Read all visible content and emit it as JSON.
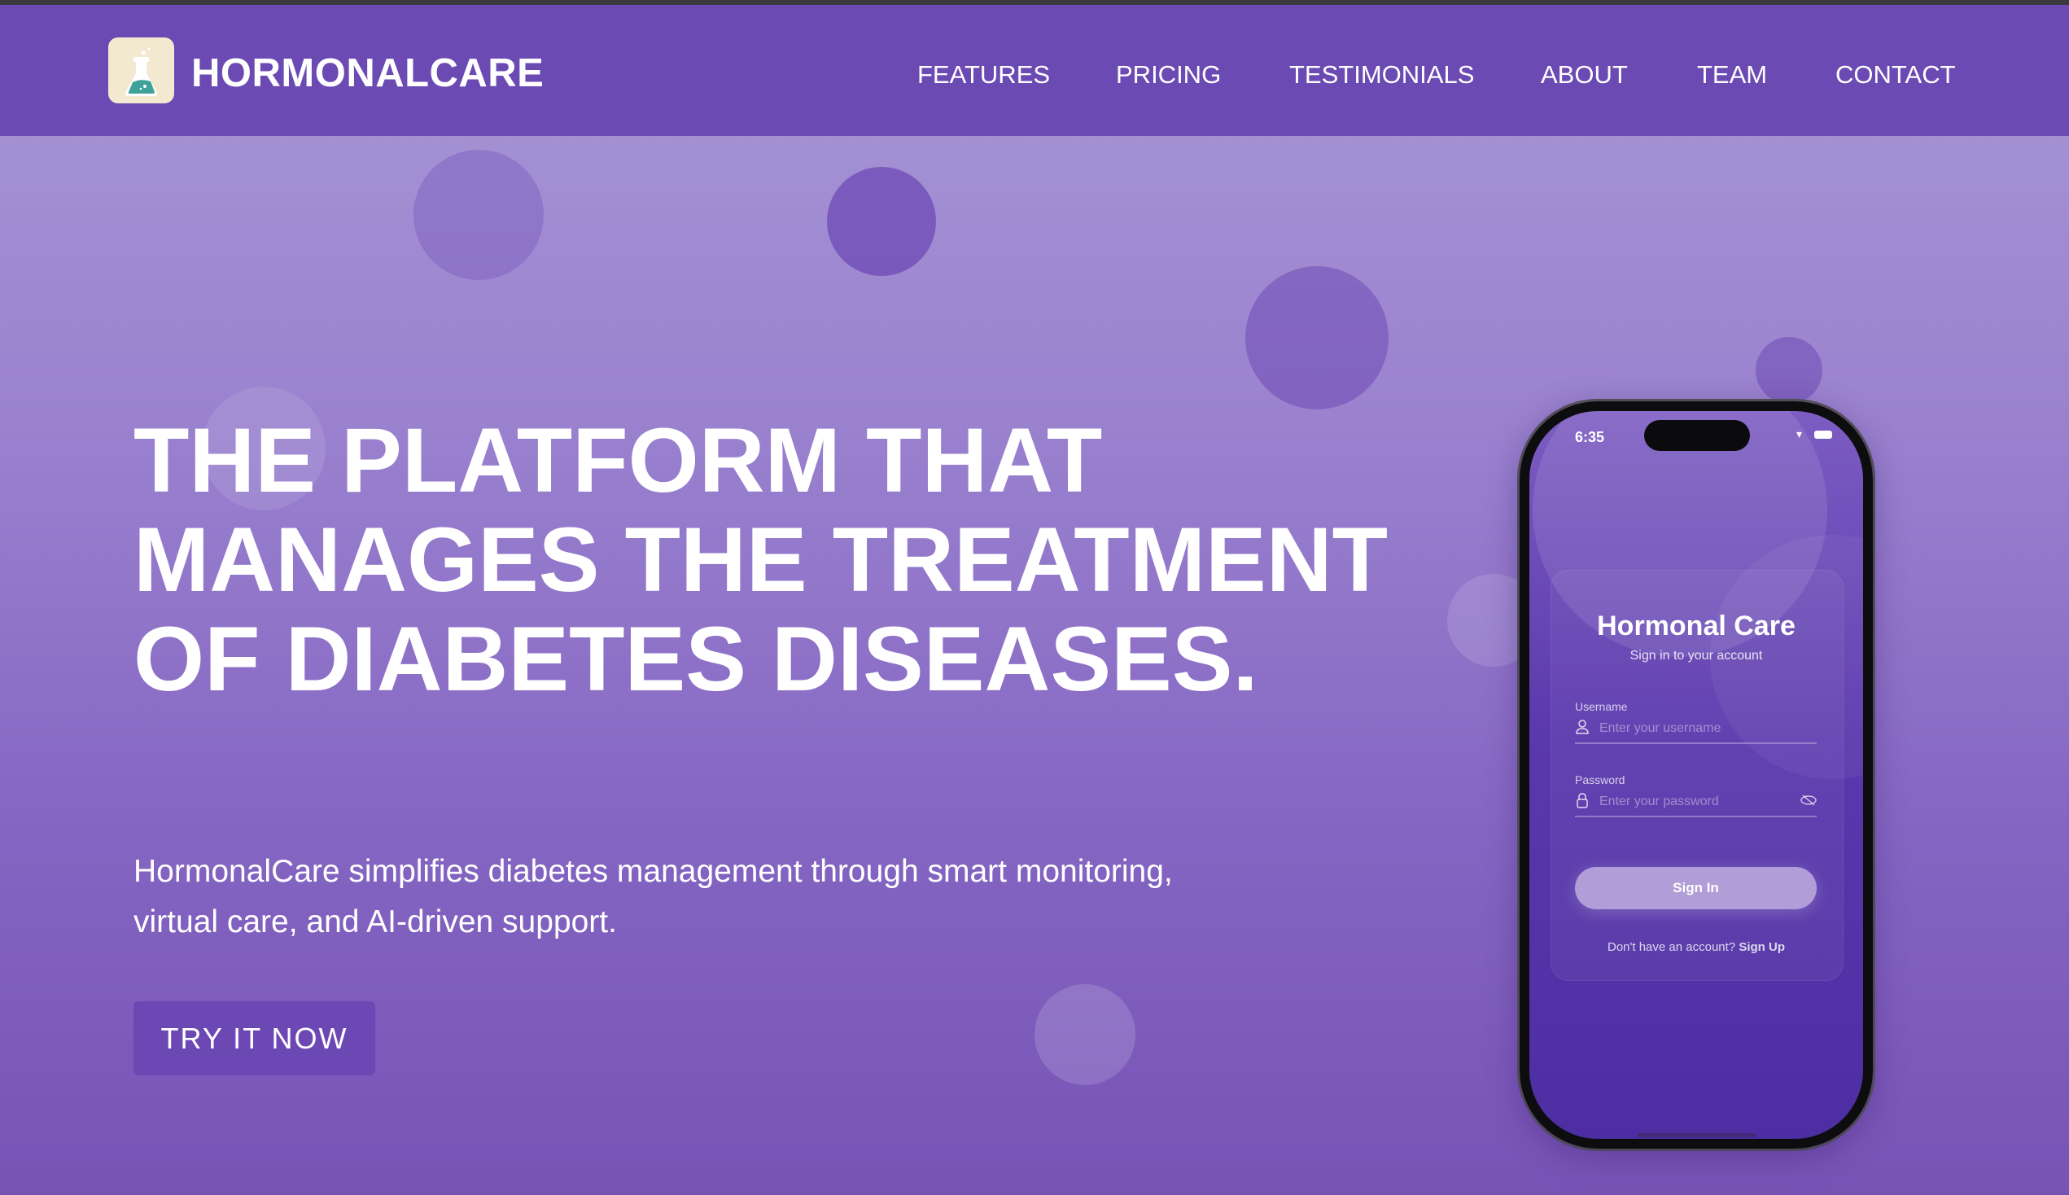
{
  "brand": {
    "name": "HORMONALCARE",
    "logo_icon": "flask-icon"
  },
  "nav": {
    "items": [
      "FEATURES",
      "PRICING",
      "TESTIMONIALS",
      "ABOUT",
      "TEAM",
      "CONTACT"
    ]
  },
  "hero": {
    "title": "THE PLATFORM THAT MANAGES THE TREATMENT OF DIABETES DISEASES.",
    "description": "HormonalCare simplifies diabetes management through smart monitoring, virtual care, and AI-driven support.",
    "cta": "TRY IT NOW"
  },
  "phone": {
    "time": "6:35",
    "app_title": "Hormonal Care",
    "subtitle": "Sign in to your account",
    "username_label": "Username",
    "username_placeholder": "Enter your username",
    "password_label": "Password",
    "password_placeholder": "Enter your password",
    "sign_in": "Sign In",
    "signup_prompt": "Don't have an account?",
    "signup_link": "Sign Up"
  },
  "colors": {
    "nav": "#6b4ab3",
    "button": "#6c48b4",
    "logo_bg": "#f3e9d0",
    "flask_liquid": "#3fa29a"
  }
}
